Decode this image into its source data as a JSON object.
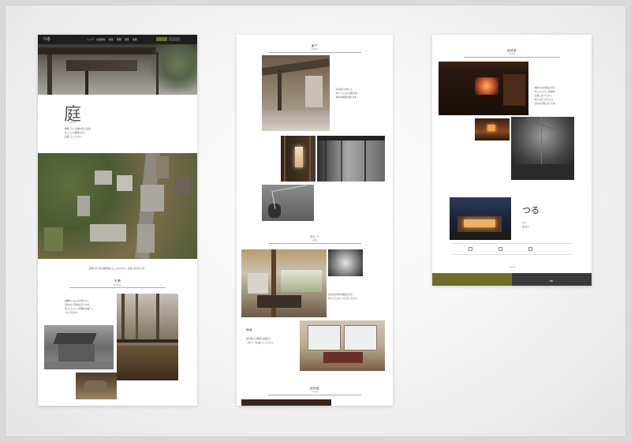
{
  "colors": {
    "accent_olive": "#6e6e2a",
    "footer_dark": "#3a3a3a",
    "nav_dark": "#1e1e1e"
  },
  "page1": {
    "logo_text": "つる",
    "nav_items": [
      "トップ",
      "お宿案内",
      "客室",
      "料理",
      "温泉",
      "交通"
    ],
    "nav_buttons": [
      "",
      ""
    ],
    "kanji_title": "庭",
    "kanji_sub": "Garden",
    "intro_lines": [
      "季節ごとに表情を変える庭を",
      "ゆっくりと眺めながら",
      "お過ごしください。"
    ],
    "caption_line": "四季それぞれの趣を味わうことのできる、自然に包まれた宿。",
    "section_title": "玄関",
    "section_sub": "Entrance",
    "section_lines": [
      "玄関を入ると木の温もりに",
      "包まれた空間が広がります。",
      "ゆったりとした時間をお過ごし",
      "いただけます。"
    ]
  },
  "page2": {
    "sec1_title": "廊下",
    "sec1_sub": "Corridor",
    "sec1_lines": [
      "木の廊下を歩くと",
      "ゆっくりと心が落ち着く",
      "静かな時間が流れます。"
    ],
    "sec2_title": "ロビー",
    "sec2_sub": "Lobby",
    "sec2_lines": [
      "窓の外の景色を眺めながら",
      "ゆったりとおくつろぎください。"
    ],
    "sec3_title": "個室",
    "sec3_lines": [
      "落ち着いた雰囲気の個室で",
      "ごゆっくりお過ごしください。"
    ],
    "sec4_title": "談話室",
    "sec4_sub": "Lounge"
  },
  "page3": {
    "sec_title": "談話室",
    "sec_sub": "Lounge",
    "sec_lines": [
      "暖炉の火を囲みながら",
      "ゆっくりとした時間を",
      "お楽しみください。",
      "夜には灯りがともり",
      "温かな空間となります。"
    ],
    "logo_text": "つる",
    "info_lines": [
      "住所",
      "電話番号"
    ],
    "social_items": [
      "",
      "",
      ""
    ],
    "footer_links": [
      "",
      "",
      "",
      "",
      "",
      ""
    ],
    "copyright": "Copyright",
    "cta_left_small": "",
    "cta_left_main": "",
    "cta_right_small": "",
    "cta_right_main": "tel."
  }
}
